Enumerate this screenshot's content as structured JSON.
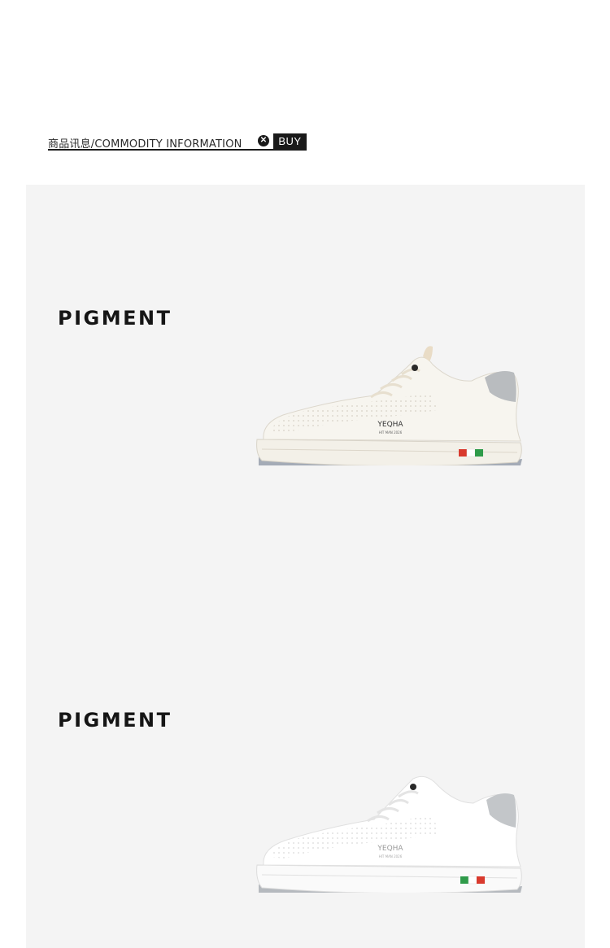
{
  "header": {
    "title": "商品讯息/COMMODITY INFORMATION",
    "separator_icon": "x-circle-icon",
    "buy_label": "BUY"
  },
  "sections": [
    {
      "title": "PIGMENT",
      "shoe": {
        "brand": "YEQHA",
        "tagline": "HIT MAN 2026",
        "color": "off-white",
        "collar_accent": "#b9bcbf",
        "sole_accent": "#8a93a2"
      }
    },
    {
      "title": "PIGMENT",
      "shoe": {
        "brand": "YEQHA",
        "tagline": "HIT MAN 2026",
        "color": "white",
        "collar_accent": "#c3c6c9",
        "sole_accent": "#9a9fa6"
      }
    }
  ],
  "colors": {
    "panel_background": "#f4f4f4",
    "text_dark": "#151515",
    "stripe_red": "#d93a2e",
    "stripe_green": "#2f9b4a"
  }
}
